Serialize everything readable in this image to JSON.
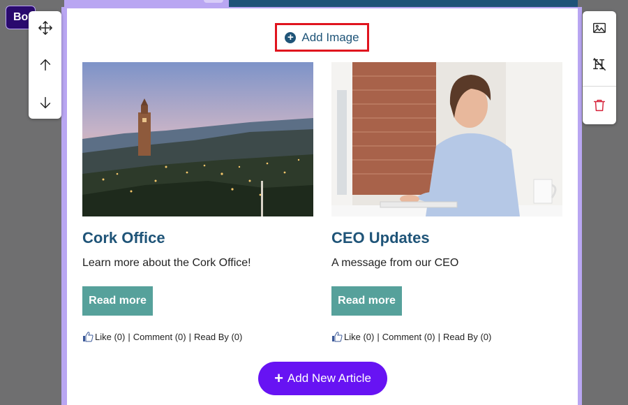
{
  "bo_chip": "Bo",
  "left_toolbar": {
    "icons": [
      "move-icon",
      "arrow-up-icon",
      "arrow-down-icon"
    ]
  },
  "right_toolbar": {
    "icons": [
      "image-icon",
      "heading-clear-icon",
      "trash-icon"
    ]
  },
  "add_image": {
    "label": "Add Image"
  },
  "articles": [
    {
      "title": "Cork Office",
      "description": "Learn more about the Cork Office!",
      "button": "Read more",
      "like": "Like (0)",
      "comment": "Comment (0)",
      "read_by": "Read By (0)",
      "separator": "|"
    },
    {
      "title": "CEO Updates",
      "description": "A message from our CEO",
      "button": "Read more",
      "like": "Like (0)",
      "comment": "Comment (0)",
      "read_by": "Read By (0)",
      "separator": "|"
    }
  ],
  "add_article": {
    "label": "Add New Article",
    "plus": "+"
  },
  "colors": {
    "accent_blue": "#1f5478",
    "button_teal": "#56a19b",
    "add_purple": "#6713f3",
    "frame_lavender": "#b9a6f2",
    "highlight_red": "#e0141e"
  }
}
